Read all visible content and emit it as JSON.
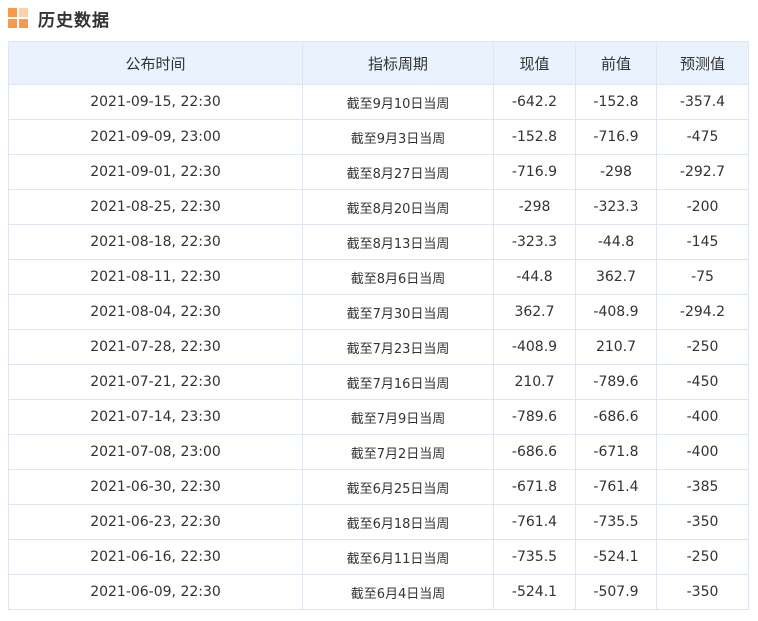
{
  "section": {
    "title": "历史数据",
    "icon": "grid-squares-icon",
    "accent_color": "#f79a4b"
  },
  "table": {
    "header_bg": "#e9f2fd",
    "columns": [
      "公布时间",
      "指标周期",
      "现值",
      "前值",
      "预测值"
    ],
    "rows": [
      {
        "time": "2021-09-15, 22:30",
        "period": "截至9月10日当周",
        "actual": "-642.2",
        "previous": "-152.8",
        "forecast": "-357.4"
      },
      {
        "time": "2021-09-09, 23:00",
        "period": "截至9月3日当周",
        "actual": "-152.8",
        "previous": "-716.9",
        "forecast": "-475"
      },
      {
        "time": "2021-09-01, 22:30",
        "period": "截至8月27日当周",
        "actual": "-716.9",
        "previous": "-298",
        "forecast": "-292.7"
      },
      {
        "time": "2021-08-25, 22:30",
        "period": "截至8月20日当周",
        "actual": "-298",
        "previous": "-323.3",
        "forecast": "-200"
      },
      {
        "time": "2021-08-18, 22:30",
        "period": "截至8月13日当周",
        "actual": "-323.3",
        "previous": "-44.8",
        "forecast": "-145"
      },
      {
        "time": "2021-08-11, 22:30",
        "period": "截至8月6日当周",
        "actual": "-44.8",
        "previous": "362.7",
        "forecast": "-75"
      },
      {
        "time": "2021-08-04, 22:30",
        "period": "截至7月30日当周",
        "actual": "362.7",
        "previous": "-408.9",
        "forecast": "-294.2"
      },
      {
        "time": "2021-07-28, 22:30",
        "period": "截至7月23日当周",
        "actual": "-408.9",
        "previous": "210.7",
        "forecast": "-250"
      },
      {
        "time": "2021-07-21, 22:30",
        "period": "截至7月16日当周",
        "actual": "210.7",
        "previous": "-789.6",
        "forecast": "-450"
      },
      {
        "time": "2021-07-14, 23:30",
        "period": "截至7月9日当周",
        "actual": "-789.6",
        "previous": "-686.6",
        "forecast": "-400"
      },
      {
        "time": "2021-07-08, 23:00",
        "period": "截至7月2日当周",
        "actual": "-686.6",
        "previous": "-671.8",
        "forecast": "-400"
      },
      {
        "time": "2021-06-30, 22:30",
        "period": "截至6月25日当周",
        "actual": "-671.8",
        "previous": "-761.4",
        "forecast": "-385"
      },
      {
        "time": "2021-06-23, 22:30",
        "period": "截至6月18日当周",
        "actual": "-761.4",
        "previous": "-735.5",
        "forecast": "-350"
      },
      {
        "time": "2021-06-16, 22:30",
        "period": "截至6月11日当周",
        "actual": "-735.5",
        "previous": "-524.1",
        "forecast": "-250"
      },
      {
        "time": "2021-06-09, 22:30",
        "period": "截至6月4日当周",
        "actual": "-524.1",
        "previous": "-507.9",
        "forecast": "-350"
      }
    ]
  }
}
